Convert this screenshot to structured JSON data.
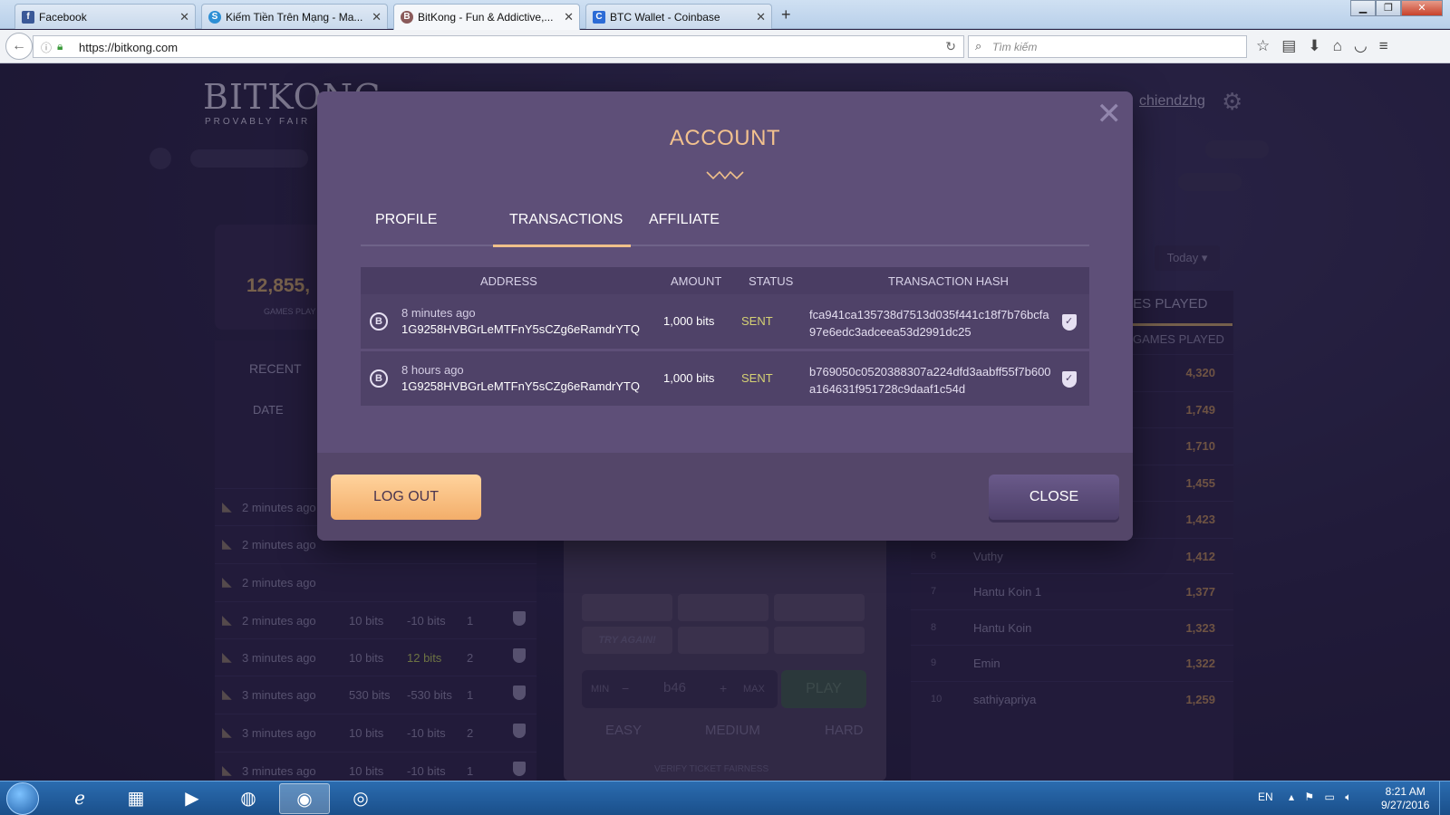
{
  "browser": {
    "tabs": [
      {
        "title": "Facebook",
        "favicon": "f",
        "color": "#3b5998"
      },
      {
        "title": "Kiếm Tiền Trên Mạng - Ma...",
        "favicon": "S",
        "color": "#2d8fd5"
      },
      {
        "title": "BitKong - Fun & Addictive,...",
        "favicon": "B",
        "color": "#8a5a5a"
      },
      {
        "title": "BTC Wallet - Coinbase",
        "favicon": "C",
        "color": "#2b6bd6"
      }
    ],
    "url": "https://bitkong.com",
    "search_placeholder": "Tìm kiếm"
  },
  "site": {
    "logo_title": "BITKONG",
    "logo_tagline": "PROVABLY FAIR",
    "username": "chiendzhg",
    "games_played_count": "12,855,",
    "games_played_label": "GAMES PLAY"
  },
  "recent": {
    "title": "RECENT",
    "date_header": "DATE",
    "rows": [
      {
        "time": "2 minutes ago",
        "bet": "",
        "profit": "",
        "count": ""
      },
      {
        "time": "2 minutes ago",
        "bet": "",
        "profit": "",
        "count": ""
      },
      {
        "time": "2 minutes ago",
        "bet": "",
        "profit": "",
        "count": ""
      },
      {
        "time": "2 minutes ago",
        "bet": "10 bits",
        "profit": "-10 bits",
        "count": "1"
      },
      {
        "time": "3 minutes ago",
        "bet": "10 bits",
        "profit": "12 bits",
        "count": "2"
      },
      {
        "time": "3 minutes ago",
        "bet": "530 bits",
        "profit": "-530 bits",
        "count": "1"
      },
      {
        "time": "3 minutes ago",
        "bet": "10 bits",
        "profit": "-10 bits",
        "count": "2"
      },
      {
        "time": "3 minutes ago",
        "bet": "10 bits",
        "profit": "-10 bits",
        "count": "1"
      },
      {
        "time": "3 minutes ago",
        "bet": "10 bits",
        "profit": "-10 bits",
        "count": "2"
      }
    ]
  },
  "game": {
    "try_again": "TRY AGAIN!",
    "min_label": "MIN",
    "max_label": "MAX",
    "bet_value": "b46",
    "play_label": "PLAY",
    "difficulties": [
      "EASY",
      "MEDIUM",
      "HARD"
    ],
    "verify_label": "VERIFY TICKET FAIRNESS"
  },
  "leaderboard": {
    "period": "Today",
    "header_tab": "IES PLAYED",
    "header_col": "GAMES PLAYED",
    "rows": [
      {
        "rank": "",
        "name": "",
        "score": "4,320"
      },
      {
        "rank": "",
        "name": "",
        "score": "1,749"
      },
      {
        "rank": "",
        "name": "",
        "score": "1,710"
      },
      {
        "rank": "",
        "name": "",
        "score": "1,455"
      },
      {
        "rank": "",
        "name": "",
        "score": "1,423"
      },
      {
        "rank": "6",
        "name": "Vuthy",
        "score": "1,412"
      },
      {
        "rank": "7",
        "name": "Hantu Koin 1",
        "score": "1,377"
      },
      {
        "rank": "8",
        "name": "Hantu Koin",
        "score": "1,323"
      },
      {
        "rank": "9",
        "name": "Emin",
        "score": "1,322"
      },
      {
        "rank": "10",
        "name": "sathiyapriya",
        "score": "1,259"
      }
    ]
  },
  "modal": {
    "title": "ACCOUNT",
    "tabs": [
      "PROFILE",
      "TRANSACTIONS",
      "AFFILIATE"
    ],
    "active_tab": "TRANSACTIONS",
    "table_headers": {
      "address": "ADDRESS",
      "amount": "AMOUNT",
      "status": "STATUS",
      "hash": "TRANSACTION HASH"
    },
    "transactions": [
      {
        "time": "8 minutes ago",
        "address": "1G9258HVBGrLeMTFnY5sCZg6eRamdrYTQ",
        "amount": "1,000 bits",
        "status": "SENT",
        "hash": "fca941ca135738d7513d035f441c18f7b76bcfa97e6edc3adceea53d2991dc25"
      },
      {
        "time": "8 hours ago",
        "address": "1G9258HVBGrLeMTFnY5sCZg6eRamdrYTQ",
        "amount": "1,000 bits",
        "status": "SENT",
        "hash": "b769050c0520388307a224dfd3aabff55f7b600a164631f951728c9daaf1c54d"
      }
    ],
    "logout_label": "LOG OUT",
    "close_label": "CLOSE",
    "colors": {
      "accent": "#f0c08a",
      "status_sent": "#d6d274",
      "modal_bg": "#5e4f78"
    }
  },
  "taskbar": {
    "language": "EN",
    "time": "8:21 AM",
    "date": "9/27/2016"
  }
}
